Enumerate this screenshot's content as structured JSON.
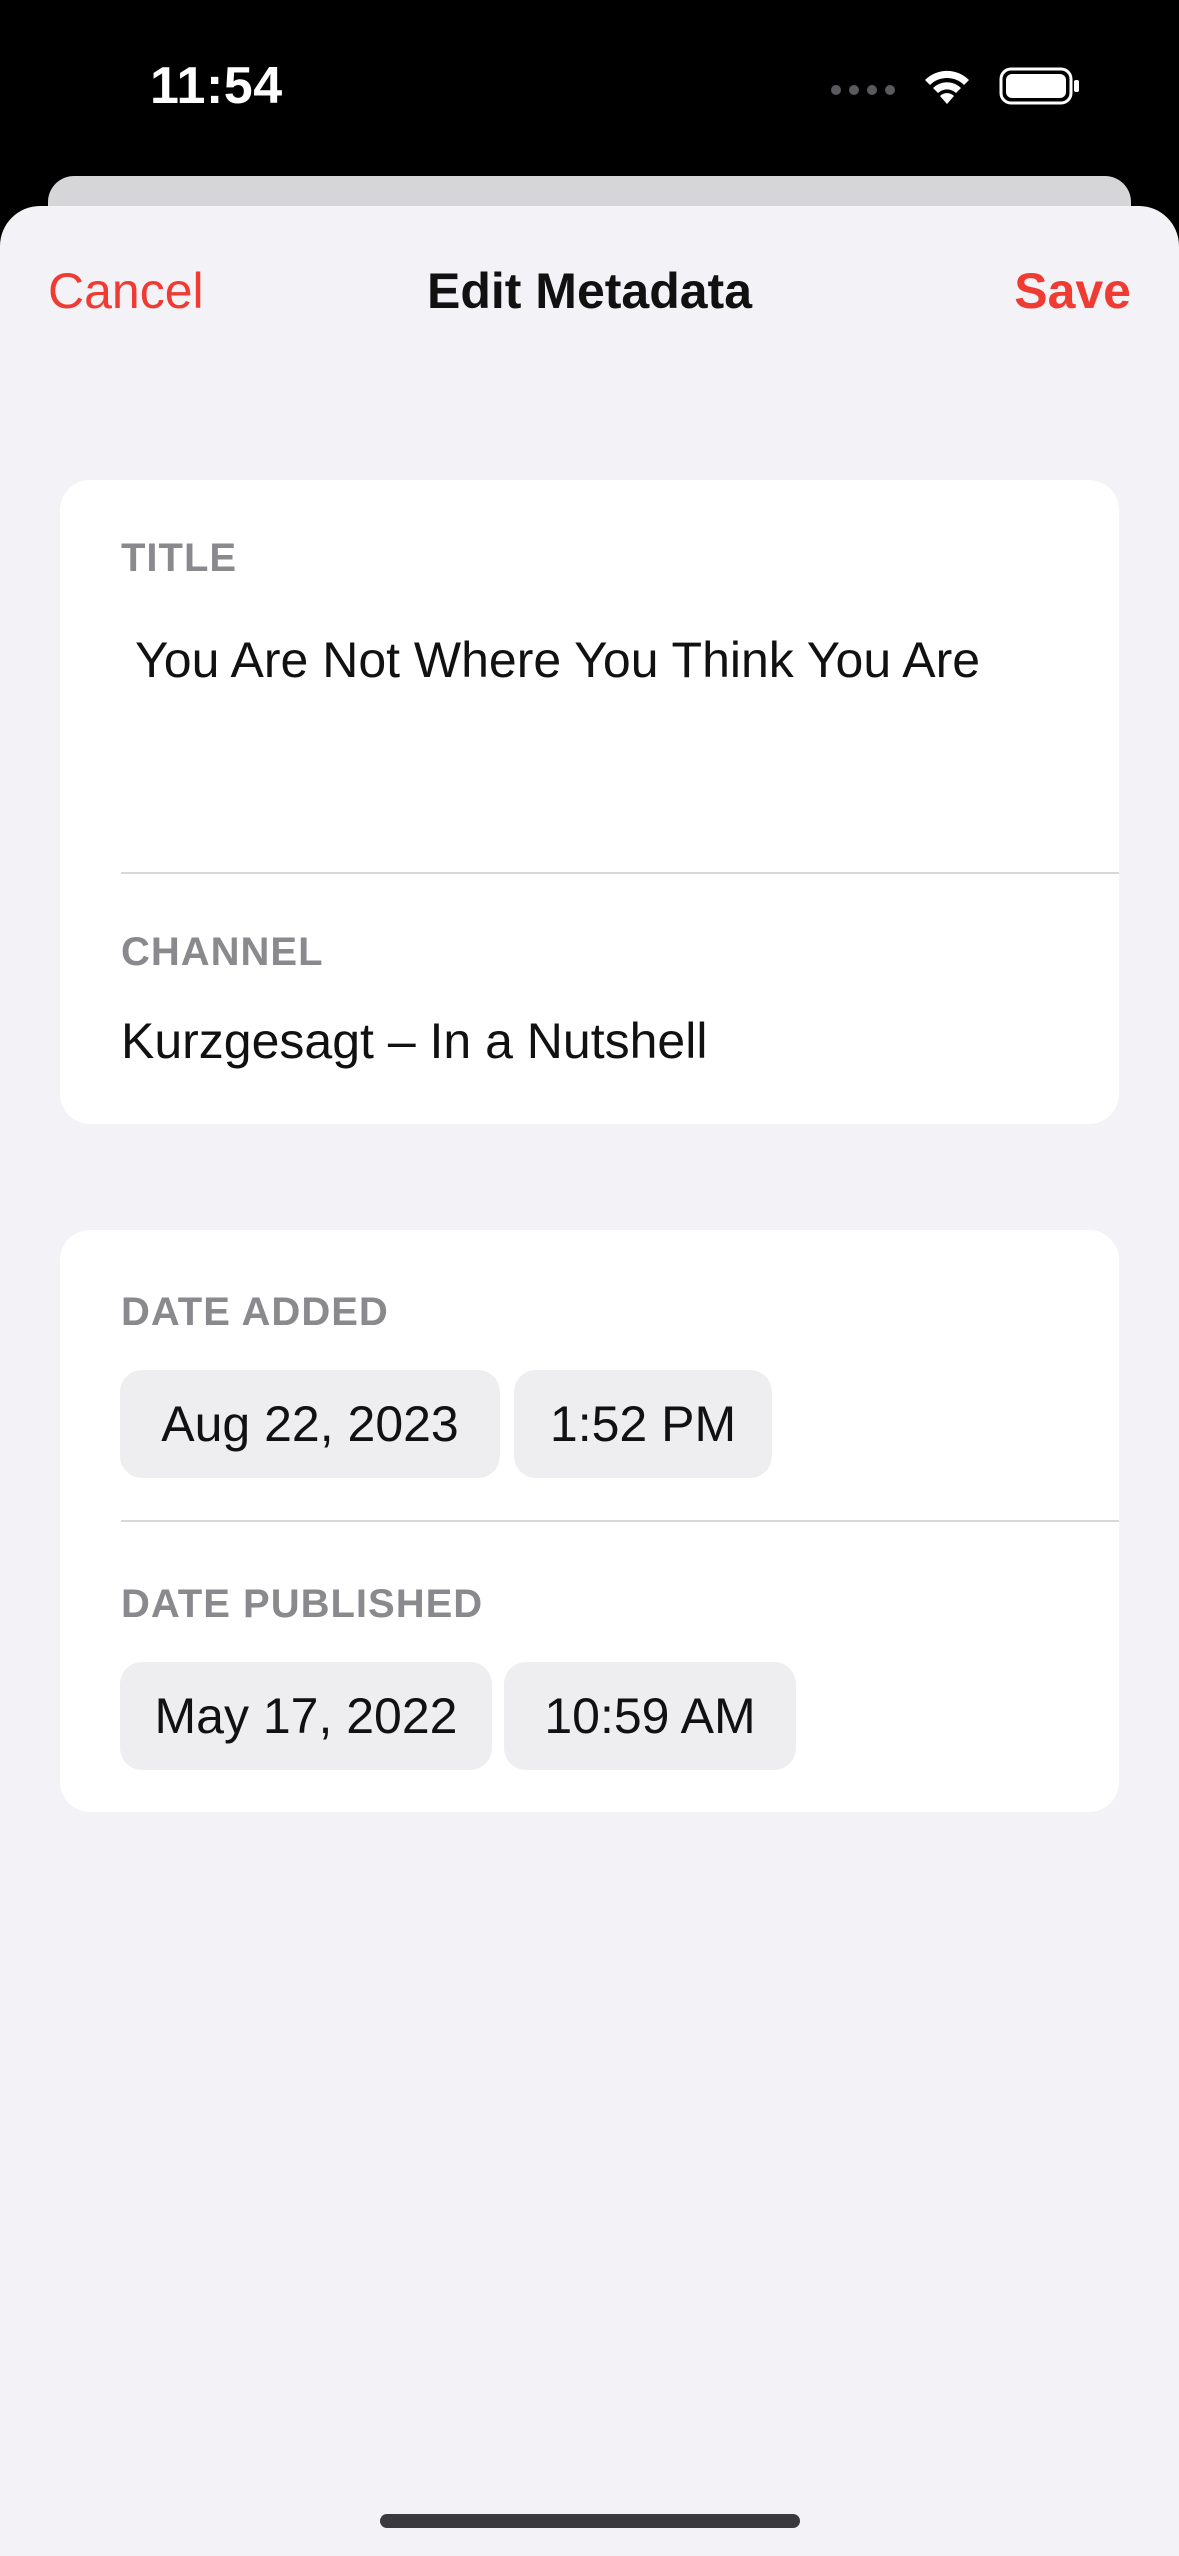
{
  "status_bar": {
    "time": "11:54",
    "icons": [
      "cellular-signal-icon",
      "wifi-icon",
      "battery-icon"
    ]
  },
  "nav": {
    "cancel_label": "Cancel",
    "title": "Edit Metadata",
    "save_label": "Save"
  },
  "metadata": {
    "title_label": "TITLE",
    "title_value": "You Are Not Where You Think You Are",
    "channel_label": "CHANNEL",
    "channel_value": "Kurzgesagt – In a Nutshell"
  },
  "dates": {
    "added_label": "DATE ADDED",
    "added_date": "Aug 22, 2023",
    "added_time": "1:52 PM",
    "published_label": "DATE PUBLISHED",
    "published_date": "May 17, 2022",
    "published_time": "10:59 AM"
  },
  "colors": {
    "accent": "#ef3b32",
    "background": "#f2f2f7",
    "card": "#ffffff",
    "secondary_label": "#8a8a8e"
  }
}
